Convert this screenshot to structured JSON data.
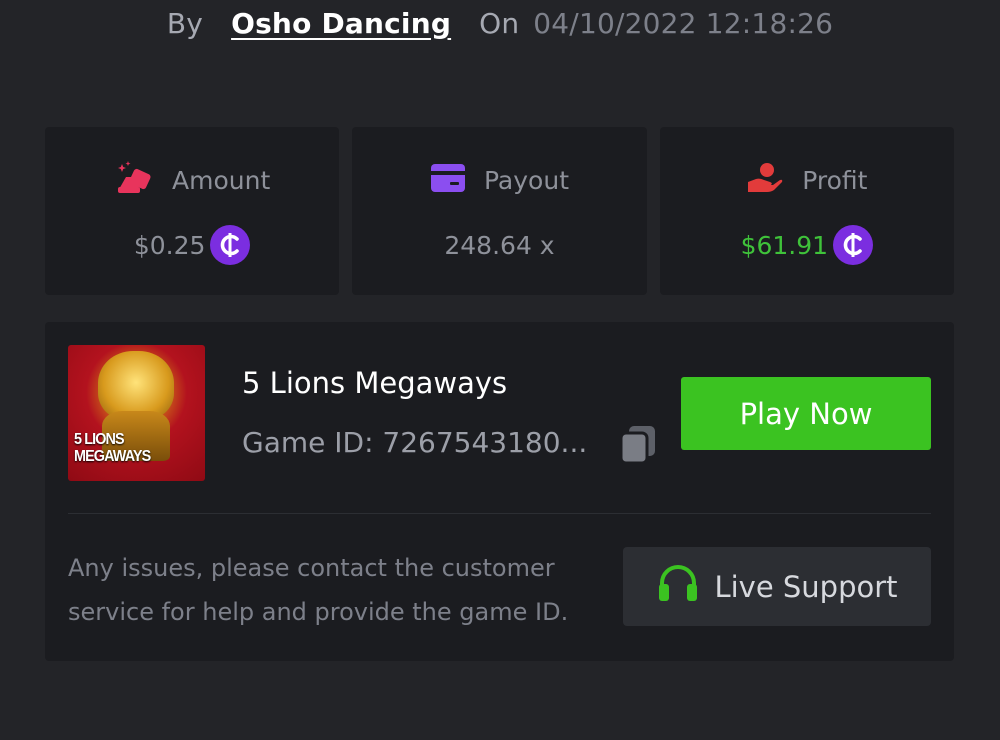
{
  "byline": {
    "by_label": "By",
    "username": "Osho Dancing",
    "on_label": "On",
    "timestamp": "04/10/2022 12:18:26"
  },
  "stats": {
    "amount": {
      "label": "Amount",
      "value": "$0.25",
      "icon": "bet-amount-icon",
      "icon_color": "#e8345c"
    },
    "payout": {
      "label": "Payout",
      "value": "248.64 x",
      "icon": "card-icon",
      "icon_color": "#8b4ef0"
    },
    "profit": {
      "label": "Profit",
      "value": "$61.91",
      "icon": "hand-coin-icon",
      "icon_color": "#e23b3b",
      "value_color": "#3fc23a"
    }
  },
  "currency_icon": {
    "name": "coin-icon",
    "symbol": "₵",
    "color": "#7b2ee0"
  },
  "game": {
    "title": "5 Lions Megaways",
    "id_text": "Game ID: 7267543180...",
    "thumbnail_text_line1": "5 LIONS",
    "thumbnail_text_line2": "MEGAWAYS",
    "play_label": "Play Now"
  },
  "support": {
    "help_text": "Any issues, please contact the customer service for help and provide the game ID.",
    "button_label": "Live Support",
    "icon": "headset-icon",
    "icon_color": "#3bc321"
  },
  "colors": {
    "background": "#232428",
    "card": "#1b1c20",
    "accent_green": "#3bc321"
  }
}
